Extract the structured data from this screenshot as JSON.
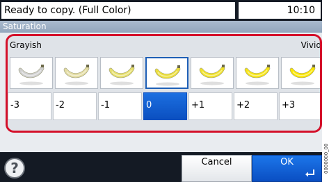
{
  "status": {
    "message": "Ready to copy. (Full Color)",
    "time": "10:10"
  },
  "screen_title": "Saturation",
  "scale": {
    "left_label": "Grayish",
    "right_label": "Vivid"
  },
  "swatch_colors": [
    "#cfcfcf",
    "#e3dca3",
    "#e6df6c",
    "#ecdf3c",
    "#f1e22a",
    "#f7e516",
    "#fbe600"
  ],
  "selected_index": 3,
  "values": [
    "-3",
    "-2",
    "-1",
    "0",
    "+1",
    "+2",
    "+3"
  ],
  "buttons": {
    "help_symbol": "?",
    "cancel_label": "Cancel",
    "ok_label": "OK"
  },
  "side_code": "0000000_00"
}
